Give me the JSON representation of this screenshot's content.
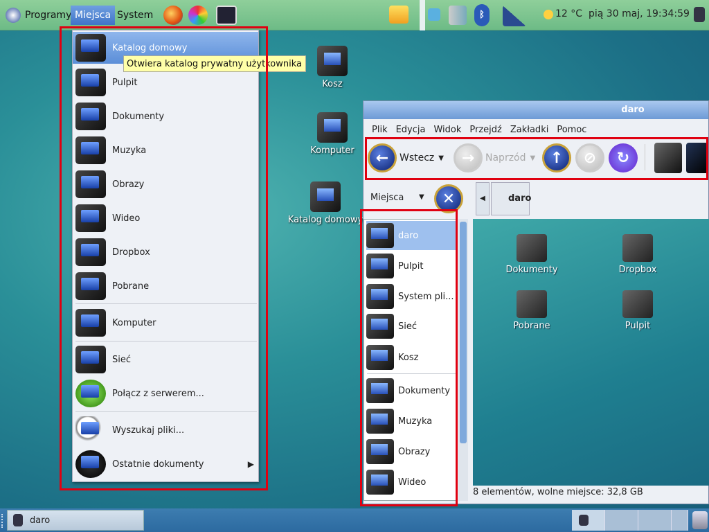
{
  "top_panel": {
    "menus": [
      "Programy",
      "Miejsca",
      "System"
    ],
    "weather": "12 °C",
    "clock": "pią 30 maj, 19:34:59"
  },
  "places_menu": {
    "items": [
      "Katalog domowy",
      "Pulpit",
      "Dokumenty",
      "Muzyka",
      "Obrazy",
      "Wideo",
      "Dropbox",
      "Pobrane",
      "Komputer",
      "Sieć",
      "Połącz z serwerem...",
      "Wyszukaj pliki...",
      "Ostatnie dokumenty"
    ],
    "tooltip": "Otwiera katalog prywatny użytkownika"
  },
  "desktop": {
    "icons": [
      "Kosz",
      "Komputer",
      "Katalog domowy"
    ]
  },
  "window": {
    "title": "daro",
    "menubar": [
      "Plik",
      "Edycja",
      "Widok",
      "Przejdź",
      "Zakładki",
      "Pomoc"
    ],
    "toolbar": {
      "back": "Wstecz",
      "forward": "Naprzód"
    },
    "side_pane_label": "Miejsca",
    "path_button": "daro",
    "side_items": [
      "daro",
      "Pulpit",
      "System pli...",
      "Sieć",
      "Kosz",
      "Dokumenty",
      "Muzyka",
      "Obrazy",
      "Wideo"
    ],
    "files": [
      "Dokumenty",
      "Dropbox",
      "Pobrane",
      "Pulpit"
    ],
    "status": "8 elementów, wolne miejsce: 32,8 GB"
  },
  "taskbar": {
    "items": [
      "daro"
    ]
  },
  "colors": {
    "highlight": "#5b8ed8",
    "annotation": "#e00010"
  }
}
